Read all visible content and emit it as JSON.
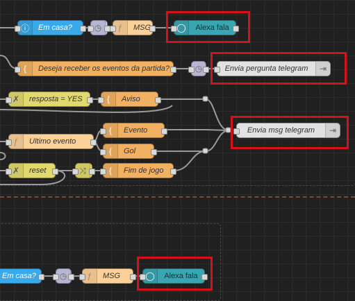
{
  "nodes": {
    "em_casa_1": "Em casa?",
    "msg_1": "MSG",
    "alexa_1": "Alexa fala",
    "deseja": "Deseja receber os eventos da partida?",
    "envia_pergunta": "Envia pergunta telegram",
    "resposta": "resposta = YES",
    "aviso": "Aviso",
    "ultimo": "Último evento",
    "evento": "Evento",
    "gol": "Gol",
    "envia_msg": "Envia msg telegram",
    "reset": "reset",
    "fim": "Fim de jogo",
    "em_casa_2": "Em casa?",
    "msg_2": "MSG",
    "alexa_2": "Alexa fala"
  },
  "icons": {
    "info": "info-icon",
    "timer": "timer-icon",
    "function": "function-icon",
    "template": "template-icon",
    "alexa": "alexa-ring-icon",
    "telegram": "telegram-send-icon",
    "change": "change-icon",
    "switch": "switch-icon"
  },
  "colors": {
    "highlight": "#d4121c",
    "canvas": "#202020"
  }
}
